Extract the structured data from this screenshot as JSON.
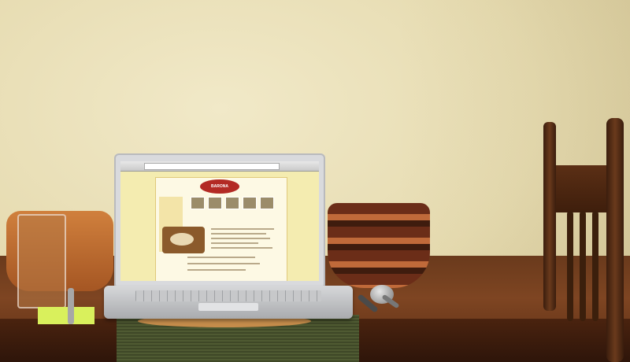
{
  "scene": {
    "description_label": "",
    "site_logo_text": "BARONA",
    "browser": {
      "tabs": [],
      "address": ""
    }
  }
}
